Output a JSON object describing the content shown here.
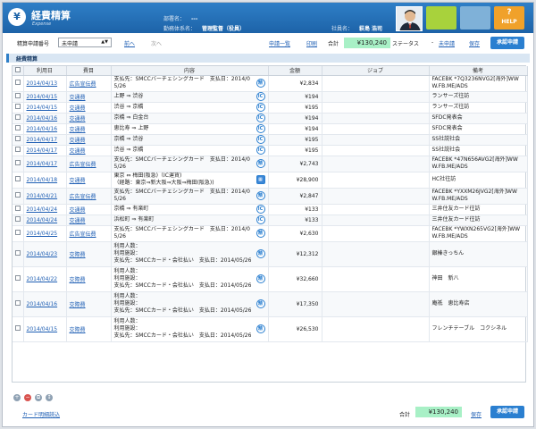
{
  "header": {
    "logo": "¥",
    "title": "経費精算",
    "subtitle": "Expense",
    "dept_label": "部署名：",
    "dept_value": "---",
    "work_label": "勤務体系名：",
    "work_value": "管理監督（役員）",
    "employee_label": "社員名：",
    "employee_value": "萩島 浩司",
    "help_label": "HELP",
    "tile_colors": [
      "#a8d23c",
      "#7fb1d8"
    ]
  },
  "toolbar": {
    "voucher_label": "精算申請番号",
    "status_select": "未申請",
    "prev": "前へ",
    "next": "次へ",
    "apply_list": "申請一覧",
    "print": "印刷",
    "total_label": "合計",
    "total_value": "¥130,240",
    "status_label": "ステータス",
    "status_dash": "-",
    "status_value": "未申請",
    "save": "保存",
    "submit": "承認申請"
  },
  "section": {
    "title": "経費精算"
  },
  "table": {
    "headers": [
      "利用日",
      "費目",
      "内容",
      "金額",
      "ジョブ",
      "備考"
    ],
    "rows": [
      {
        "date": "2014/04/13",
        "item": "広告宣伝費",
        "content": "支払先：SMCCバーチェシングカード　支払日：2014/0\n5/26",
        "amount": "¥2,834",
        "job": "",
        "note": "FACEBK *7Q3236NVG2[海外]WW\nW.FB.ME/ADS",
        "icon": "card"
      },
      {
        "date": "2014/04/15",
        "item": "交通費",
        "content": "上野 ⇒ 渋谷",
        "amount": "¥194",
        "job": "",
        "note": "ランサーズ往訪",
        "icon": "ic"
      },
      {
        "date": "2014/04/15",
        "item": "交通費",
        "content": "渋谷 ⇒ 京橋",
        "amount": "¥195",
        "job": "",
        "note": "ランサーズ往訪",
        "icon": "ic"
      },
      {
        "date": "2014/04/16",
        "item": "交通費",
        "content": "京橋 ⇒ 白金台",
        "amount": "¥194",
        "job": "",
        "note": "SFDC発表会",
        "icon": "ic"
      },
      {
        "date": "2014/04/16",
        "item": "交通費",
        "content": "恵比寿 ⇒ 上野",
        "amount": "¥194",
        "job": "",
        "note": "SFDC発表会",
        "icon": "ic"
      },
      {
        "date": "2014/04/17",
        "item": "交通費",
        "content": "京橋 ⇒ 渋谷",
        "amount": "¥195",
        "job": "",
        "note": "SS社説社会",
        "icon": "ic"
      },
      {
        "date": "2014/04/17",
        "item": "交通費",
        "content": "渋谷 ⇒ 京橋",
        "amount": "¥195",
        "job": "",
        "note": "SS社説社会",
        "icon": "ic"
      },
      {
        "date": "2014/04/17",
        "item": "広告宣伝費",
        "content": "支払先：SMCCバーチェシングカード　支払日：2014/0\n5/26",
        "amount": "¥2,743",
        "job": "",
        "note": "FACEBK *47N656AVG2[海外]WW\nW.FB.ME/ADS",
        "icon": "card"
      },
      {
        "date": "2014/04/18",
        "item": "交通費",
        "content": "東京 ⇔ 梅田(阪急)（IC運賃)\n（経路：東京⇒新大阪⇒大阪⇒梅田(阪急))",
        "amount": "¥28,900",
        "job": "",
        "note": "HC社往訪",
        "icon": "train"
      },
      {
        "date": "2014/04/21",
        "item": "広告宣伝費",
        "content": "支払先：SMCCバーチェシングカード　支払日：2014/0\n5/26",
        "amount": "¥2,847",
        "job": "",
        "note": "FACEBK *YXXM26JVG2[海外]WW\nW.FB.ME/ADS",
        "icon": "card"
      },
      {
        "date": "2014/04/24",
        "item": "交通費",
        "content": "京橋 ⇒ 有楽町",
        "amount": "¥133",
        "job": "",
        "note": "三井住友カード往訪",
        "icon": "ic"
      },
      {
        "date": "2014/04/24",
        "item": "交通費",
        "content": "浜松町 ⇒ 有楽町",
        "amount": "¥133",
        "job": "",
        "note": "三井住友カード往訪",
        "icon": "ic"
      },
      {
        "date": "2014/04/25",
        "item": "広告宣伝費",
        "content": "支払先：SMCCバーチェシングカード　支払日：2014/0\n5/26",
        "amount": "¥2,630",
        "job": "",
        "note": "FACEBK *YWXN265VG2[海外]WW\nW.FB.ME/ADS",
        "icon": "card"
      },
      {
        "date": "2014/04/23",
        "item": "交際費",
        "content": "利用人数：\n利用施設：\n支払先：SMCCカード・会社払い　支払日：2014/05/26",
        "amount": "¥12,312",
        "job": "",
        "note": "銀榛きっちん",
        "icon": "card"
      },
      {
        "date": "2014/04/22",
        "item": "交際費",
        "content": "利用人数：\n利用施設：\n支払先：SMCCカード・会社払い　支払日：2014/05/26",
        "amount": "¥32,660",
        "job": "",
        "note": "神田　新八",
        "icon": "card"
      },
      {
        "date": "2014/04/16",
        "item": "交際費",
        "content": "利用人数：\n利用施設：\n支払先：SMCCカード・会社払い　支払日：2014/05/26",
        "amount": "¥17,350",
        "job": "",
        "note": "庵祇　恵比寿店",
        "icon": "card"
      },
      {
        "date": "2014/04/15",
        "item": "交際費",
        "content": "利用人数：\n利用施設：\n支払先：SMCCカード・会社払い　支払日：2014/05/26",
        "amount": "¥26,530",
        "job": "",
        "note": "フレンチテーブル　コクシネル",
        "icon": "card"
      }
    ]
  },
  "footer": {
    "card_import": "カード明細読込",
    "total_label": "合計",
    "total_value": "¥130,240",
    "save": "保存",
    "submit": "承認申請"
  }
}
